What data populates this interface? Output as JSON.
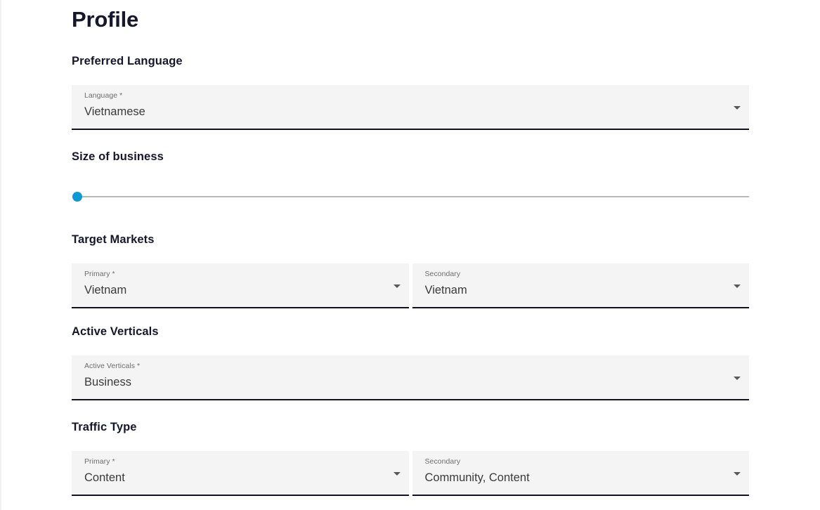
{
  "page": {
    "title": "Profile"
  },
  "sections": [
    {
      "heading": "Preferred Language",
      "type": "single-select",
      "fields": [
        {
          "label": "Language",
          "required": true,
          "required_marker": "*",
          "value": "Vietnamese",
          "icon": "chevron-down-icon"
        }
      ]
    },
    {
      "heading": "Size of business",
      "type": "slider",
      "slider": {
        "value": 0,
        "min": 0,
        "max": 100,
        "thumb_position_percent": 0,
        "thumb_color": "#0d98d6",
        "track_color": "#b6b6b6"
      }
    },
    {
      "heading": "Target Markets",
      "type": "two-column-select",
      "fields": [
        {
          "label": "Primary",
          "required": true,
          "required_marker": "*",
          "value": "Vietnam",
          "icon": "chevron-down-icon"
        },
        {
          "label": "Secondary",
          "required": false,
          "required_marker": "",
          "value": "Vietnam",
          "icon": "chevron-down-icon"
        }
      ]
    },
    {
      "heading": "Active Verticals",
      "type": "single-select",
      "fields": [
        {
          "label": "Active Verticals",
          "required": true,
          "required_marker": "*",
          "value": "Business",
          "icon": "chevron-down-icon"
        }
      ]
    },
    {
      "heading": "Traffic Type",
      "type": "two-column-select",
      "fields": [
        {
          "label": "Primary",
          "required": true,
          "required_marker": "*",
          "value": "Content",
          "icon": "chevron-down-icon"
        },
        {
          "label": "Secondary",
          "required": false,
          "required_marker": "",
          "value": "Community, Content",
          "icon": "chevron-down-icon"
        }
      ]
    }
  ],
  "colors": {
    "accent": "#0d98d6",
    "field_background": "#f4f4f4",
    "field_underline": "#111122",
    "heading": "#16162c",
    "label": "#6d6d6d",
    "value": "#3a3a3a"
  }
}
